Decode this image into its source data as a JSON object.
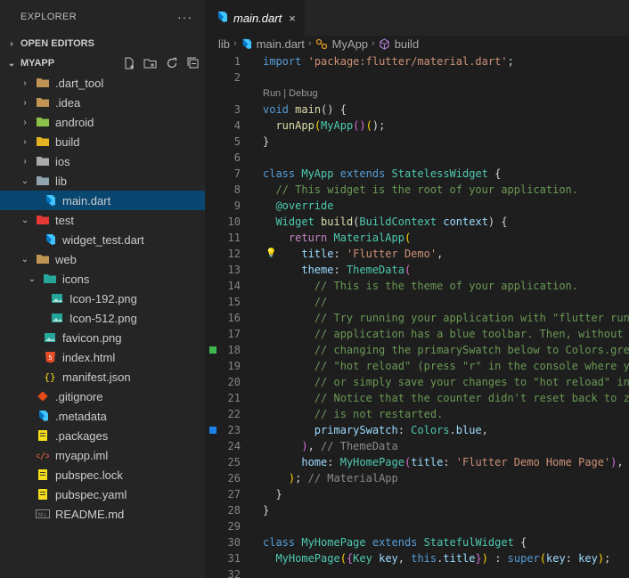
{
  "sidebar": {
    "title": "EXPLORER",
    "more": "···",
    "open_editors": "OPEN EDITORS",
    "project": "MYAPP",
    "tree": [
      {
        "label": ".dart_tool",
        "depth": 0,
        "chev": "›",
        "icon": "folder-icon",
        "color": "#c09553"
      },
      {
        "label": ".idea",
        "depth": 0,
        "chev": "›",
        "icon": "idea-folder-icon",
        "color": "#c09553"
      },
      {
        "label": "android",
        "depth": 0,
        "chev": "›",
        "icon": "android-folder-icon",
        "color": "#8bc34a"
      },
      {
        "label": "build",
        "depth": 0,
        "chev": "›",
        "icon": "build-folder-icon",
        "color": "#e6b422"
      },
      {
        "label": "ios",
        "depth": 0,
        "chev": "›",
        "icon": "ios-folder-icon",
        "color": "#aaaaaa"
      },
      {
        "label": "lib",
        "depth": 0,
        "chev": "⌄",
        "icon": "lib-folder-icon",
        "color": "#90a4ae"
      },
      {
        "label": "main.dart",
        "depth": 1,
        "chev": "",
        "icon": "dart-file-icon",
        "color": "#40c4ff",
        "selected": true
      },
      {
        "label": "test",
        "depth": 0,
        "chev": "⌄",
        "icon": "test-folder-icon",
        "color": "#e53935"
      },
      {
        "label": "widget_test.dart",
        "depth": 1,
        "chev": "",
        "icon": "dart-file-icon",
        "color": "#40c4ff"
      },
      {
        "label": "web",
        "depth": 0,
        "chev": "⌄",
        "icon": "web-folder-icon",
        "color": "#c09553"
      },
      {
        "label": "icons",
        "depth": 1,
        "chev": "⌄",
        "icon": "images-folder-icon",
        "color": "#26a69a"
      },
      {
        "label": "Icon-192.png",
        "depth": 2,
        "chev": "",
        "icon": "image-file-icon",
        "color": "#26a69a"
      },
      {
        "label": "Icon-512.png",
        "depth": 2,
        "chev": "",
        "icon": "image-file-icon",
        "color": "#26a69a"
      },
      {
        "label": "favicon.png",
        "depth": 1,
        "chev": "",
        "icon": "image-file-icon",
        "color": "#26a69a"
      },
      {
        "label": "index.html",
        "depth": 1,
        "chev": "",
        "icon": "html-file-icon",
        "color": "#e44d26"
      },
      {
        "label": "manifest.json",
        "depth": 1,
        "chev": "",
        "icon": "json-file-icon",
        "color": "#f5de19"
      },
      {
        "label": ".gitignore",
        "depth": 0,
        "chev": "",
        "icon": "git-file-icon",
        "color": "#e64a19"
      },
      {
        "label": ".metadata",
        "depth": 0,
        "chev": "",
        "icon": "flutter-file-icon",
        "color": "#40c4ff"
      },
      {
        "label": ".packages",
        "depth": 0,
        "chev": "",
        "icon": "yaml-file-icon",
        "color": "#f5de19"
      },
      {
        "label": "myapp.iml",
        "depth": 0,
        "chev": "",
        "icon": "xml-file-icon",
        "color": "#ff7043"
      },
      {
        "label": "pubspec.lock",
        "depth": 0,
        "chev": "",
        "icon": "yaml-file-icon",
        "color": "#f5de19"
      },
      {
        "label": "pubspec.yaml",
        "depth": 0,
        "chev": "",
        "icon": "yaml-file-icon",
        "color": "#f5de19"
      },
      {
        "label": "README.md",
        "depth": 0,
        "chev": "",
        "icon": "markdown-file-icon",
        "color": "#888888"
      }
    ]
  },
  "editor": {
    "tab_label": "main.dart",
    "tab_close": "×",
    "breadcrumb": {
      "folder": "lib",
      "file": "main.dart",
      "class": "MyApp",
      "method": "build"
    },
    "codelens": "Run | Debug",
    "lines": [
      {
        "n": "1",
        "t": [
          [
            "kw",
            "import"
          ],
          [
            "pu",
            " "
          ],
          [
            "str",
            "'package:flutter/material.dart'"
          ],
          [
            "pu",
            ";"
          ]
        ]
      },
      {
        "n": "2",
        "t": []
      },
      {
        "n": "3",
        "lens": true,
        "t": [
          [
            "kw",
            "void"
          ],
          [
            "pu",
            " "
          ],
          [
            "fn",
            "main"
          ],
          [
            "pu",
            "() {"
          ]
        ]
      },
      {
        "n": "4",
        "t": [
          [
            "pu",
            "  "
          ],
          [
            "fn",
            "runApp"
          ],
          [
            "br",
            "("
          ],
          [
            "ty",
            "MyApp"
          ],
          [
            "br2",
            "()"
          ],
          [
            "br",
            "("
          ],
          [
            "pu",
            ");"
          ]
        ]
      },
      {
        "n": "5",
        "t": [
          [
            "pu",
            "}"
          ]
        ]
      },
      {
        "n": "6",
        "t": []
      },
      {
        "n": "7",
        "t": [
          [
            "kw",
            "class"
          ],
          [
            "pu",
            " "
          ],
          [
            "ty",
            "MyApp"
          ],
          [
            "pu",
            " "
          ],
          [
            "kw",
            "extends"
          ],
          [
            "pu",
            " "
          ],
          [
            "ty",
            "StatelessWidget"
          ],
          [
            "pu",
            " {"
          ]
        ]
      },
      {
        "n": "8",
        "t": [
          [
            "pu",
            "  "
          ],
          [
            "cm",
            "// This widget is the root of your application."
          ]
        ]
      },
      {
        "n": "9",
        "t": [
          [
            "pu",
            "  "
          ],
          [
            "ty",
            "@override"
          ]
        ]
      },
      {
        "n": "10",
        "t": [
          [
            "pu",
            "  "
          ],
          [
            "ty",
            "Widget"
          ],
          [
            "pu",
            " "
          ],
          [
            "fn",
            "build"
          ],
          [
            "pu",
            "("
          ],
          [
            "ty",
            "BuildContext"
          ],
          [
            "pu",
            " "
          ],
          [
            "pr",
            "context"
          ],
          [
            "pu",
            ") {"
          ]
        ]
      },
      {
        "n": "11",
        "t": [
          [
            "pu",
            "    "
          ],
          [
            "ctl",
            "return"
          ],
          [
            "pu",
            " "
          ],
          [
            "ty",
            "MaterialApp"
          ],
          [
            "br",
            "("
          ]
        ]
      },
      {
        "n": "12",
        "bulb": true,
        "t": [
          [
            "pu",
            "      "
          ],
          [
            "pr",
            "title"
          ],
          [
            "pu",
            ": "
          ],
          [
            "str",
            "'Flutter Demo'"
          ],
          [
            "pu",
            ","
          ]
        ]
      },
      {
        "n": "13",
        "t": [
          [
            "pu",
            "      "
          ],
          [
            "pr",
            "theme"
          ],
          [
            "pu",
            ": "
          ],
          [
            "ty",
            "ThemeData"
          ],
          [
            "br2",
            "("
          ]
        ]
      },
      {
        "n": "14",
        "t": [
          [
            "pu",
            "        "
          ],
          [
            "cm",
            "// This is the theme of your application."
          ]
        ]
      },
      {
        "n": "15",
        "t": [
          [
            "pu",
            "        "
          ],
          [
            "cm",
            "//"
          ]
        ]
      },
      {
        "n": "16",
        "t": [
          [
            "pu",
            "        "
          ],
          [
            "cm",
            "// Try running your application with \"flutter run\". You'll see the"
          ]
        ]
      },
      {
        "n": "17",
        "t": [
          [
            "pu",
            "        "
          ],
          [
            "cm",
            "// application has a blue toolbar. Then, without quitting the app, try"
          ]
        ]
      },
      {
        "n": "18",
        "mark": "#3fb950",
        "t": [
          [
            "pu",
            "        "
          ],
          [
            "cm",
            "// changing the primarySwatch below to Colors.green and then invoke"
          ]
        ]
      },
      {
        "n": "19",
        "t": [
          [
            "pu",
            "        "
          ],
          [
            "cm",
            "// \"hot reload\" (press \"r\" in the console where you ran \"flutter run\","
          ]
        ]
      },
      {
        "n": "20",
        "t": [
          [
            "pu",
            "        "
          ],
          [
            "cm",
            "// or simply save your changes to \"hot reload\" in a Flutter IDE)."
          ]
        ]
      },
      {
        "n": "21",
        "t": [
          [
            "pu",
            "        "
          ],
          [
            "cm",
            "// Notice that the counter didn't reset back to zero; the application"
          ]
        ]
      },
      {
        "n": "22",
        "t": [
          [
            "pu",
            "        "
          ],
          [
            "cm",
            "// is not restarted."
          ]
        ]
      },
      {
        "n": "23",
        "mark": "#1b81e8",
        "t": [
          [
            "pu",
            "        "
          ],
          [
            "pr",
            "primarySwatch"
          ],
          [
            "pu",
            ": "
          ],
          [
            "ty",
            "Colors"
          ],
          [
            "pu",
            "."
          ],
          [
            "pr",
            "blue"
          ],
          [
            "pu",
            ","
          ]
        ]
      },
      {
        "n": "24",
        "t": [
          [
            "pu",
            "      "
          ],
          [
            "br2",
            ")"
          ],
          [
            "pu",
            ", "
          ],
          [
            "hint",
            "// ThemeData"
          ]
        ]
      },
      {
        "n": "25",
        "t": [
          [
            "pu",
            "      "
          ],
          [
            "pr",
            "home"
          ],
          [
            "pu",
            ": "
          ],
          [
            "ty",
            "MyHomePage"
          ],
          [
            "br2",
            "("
          ],
          [
            "pr",
            "title"
          ],
          [
            "pu",
            ": "
          ],
          [
            "str",
            "'Flutter Demo Home Page'"
          ],
          [
            "br2",
            ")"
          ],
          [
            "pu",
            ","
          ]
        ]
      },
      {
        "n": "26",
        "t": [
          [
            "pu",
            "    "
          ],
          [
            "br",
            ")"
          ],
          [
            "pu",
            "; "
          ],
          [
            "hint",
            "// MaterialApp"
          ]
        ]
      },
      {
        "n": "27",
        "t": [
          [
            "pu",
            "  }"
          ]
        ]
      },
      {
        "n": "28",
        "t": [
          [
            "pu",
            "}"
          ]
        ]
      },
      {
        "n": "29",
        "t": []
      },
      {
        "n": "30",
        "t": [
          [
            "kw",
            "class"
          ],
          [
            "pu",
            " "
          ],
          [
            "ty",
            "MyHomePage"
          ],
          [
            "pu",
            " "
          ],
          [
            "kw",
            "extends"
          ],
          [
            "pu",
            " "
          ],
          [
            "ty",
            "StatefulWidget"
          ],
          [
            "pu",
            " {"
          ]
        ]
      },
      {
        "n": "31",
        "t": [
          [
            "pu",
            "  "
          ],
          [
            "ty",
            "MyHomePage"
          ],
          [
            "br",
            "("
          ],
          [
            "br2",
            "{"
          ],
          [
            "ty",
            "Key"
          ],
          [
            "pu",
            " "
          ],
          [
            "pr",
            "key"
          ],
          [
            "pu",
            ", "
          ],
          [
            "kw",
            "this"
          ],
          [
            "pu",
            "."
          ],
          [
            "pr",
            "title"
          ],
          [
            "br2",
            "}"
          ],
          [
            "br",
            ")"
          ],
          [
            "pu",
            " : "
          ],
          [
            "kw",
            "super"
          ],
          [
            "br",
            "("
          ],
          [
            "pr",
            "key"
          ],
          [
            "pu",
            ": "
          ],
          [
            "pr",
            "key"
          ],
          [
            "br",
            ")"
          ],
          [
            "pu",
            ";"
          ]
        ]
      },
      {
        "n": "32",
        "t": []
      }
    ]
  }
}
